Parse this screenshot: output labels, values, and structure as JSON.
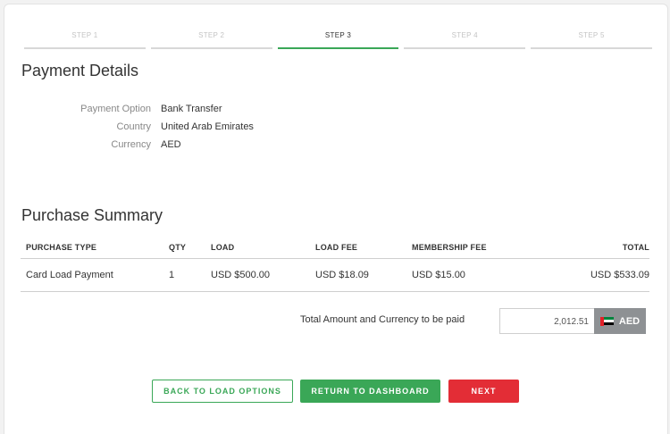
{
  "steps": [
    "STEP 1",
    "STEP 2",
    "STEP 3",
    "STEP 4",
    "STEP 5"
  ],
  "active_step": 3,
  "payment": {
    "title": "Payment Details",
    "rows": [
      {
        "label": "Payment Option",
        "value": "Bank Transfer"
      },
      {
        "label": "Country",
        "value": "United Arab Emirates"
      },
      {
        "label": "Currency",
        "value": "AED"
      }
    ]
  },
  "summary": {
    "title": "Purchase Summary",
    "headers": [
      "PURCHASE TYPE",
      "QTY",
      "LOAD",
      "LOAD FEE",
      "MEMBERSHIP FEE",
      "TOTAL"
    ],
    "rows": [
      [
        "Card Load Payment",
        "1",
        "USD $500.00",
        "USD $18.09",
        "USD $15.00",
        "USD $533.09"
      ]
    ]
  },
  "total": {
    "label": "Total Amount and Currency to be paid",
    "amount": "2,012.51",
    "currency": "AED",
    "flag_icon": "uae-flag-icon"
  },
  "buttons": {
    "back": "BACK TO LOAD OPTIONS",
    "dashboard": "RETURN TO DASHBOARD",
    "next": "NEXT"
  },
  "colors": {
    "accent_green": "#3aa757",
    "next_red": "#e32d36",
    "currency_grey": "#8e9194"
  }
}
